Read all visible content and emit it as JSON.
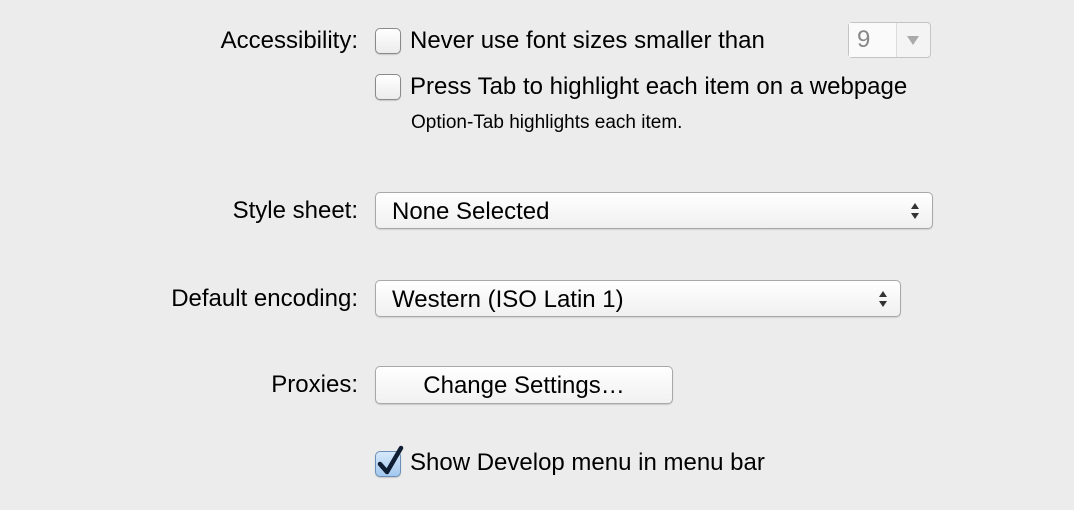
{
  "accessibility": {
    "label": "Accessibility:",
    "min_font_checkbox": {
      "label": "Never use font sizes smaller than",
      "checked": false
    },
    "min_font_value": "9",
    "tab_checkbox": {
      "label": "Press Tab to highlight each item on a webpage",
      "checked": false
    },
    "tab_hint": "Option-Tab highlights each item."
  },
  "style_sheet": {
    "label": "Style sheet:",
    "value": "None Selected"
  },
  "encoding": {
    "label": "Default encoding:",
    "value": "Western (ISO Latin 1)"
  },
  "proxies": {
    "label": "Proxies:",
    "button": "Change Settings…"
  },
  "develop_menu": {
    "label": "Show Develop menu in menu bar",
    "checked": true
  }
}
